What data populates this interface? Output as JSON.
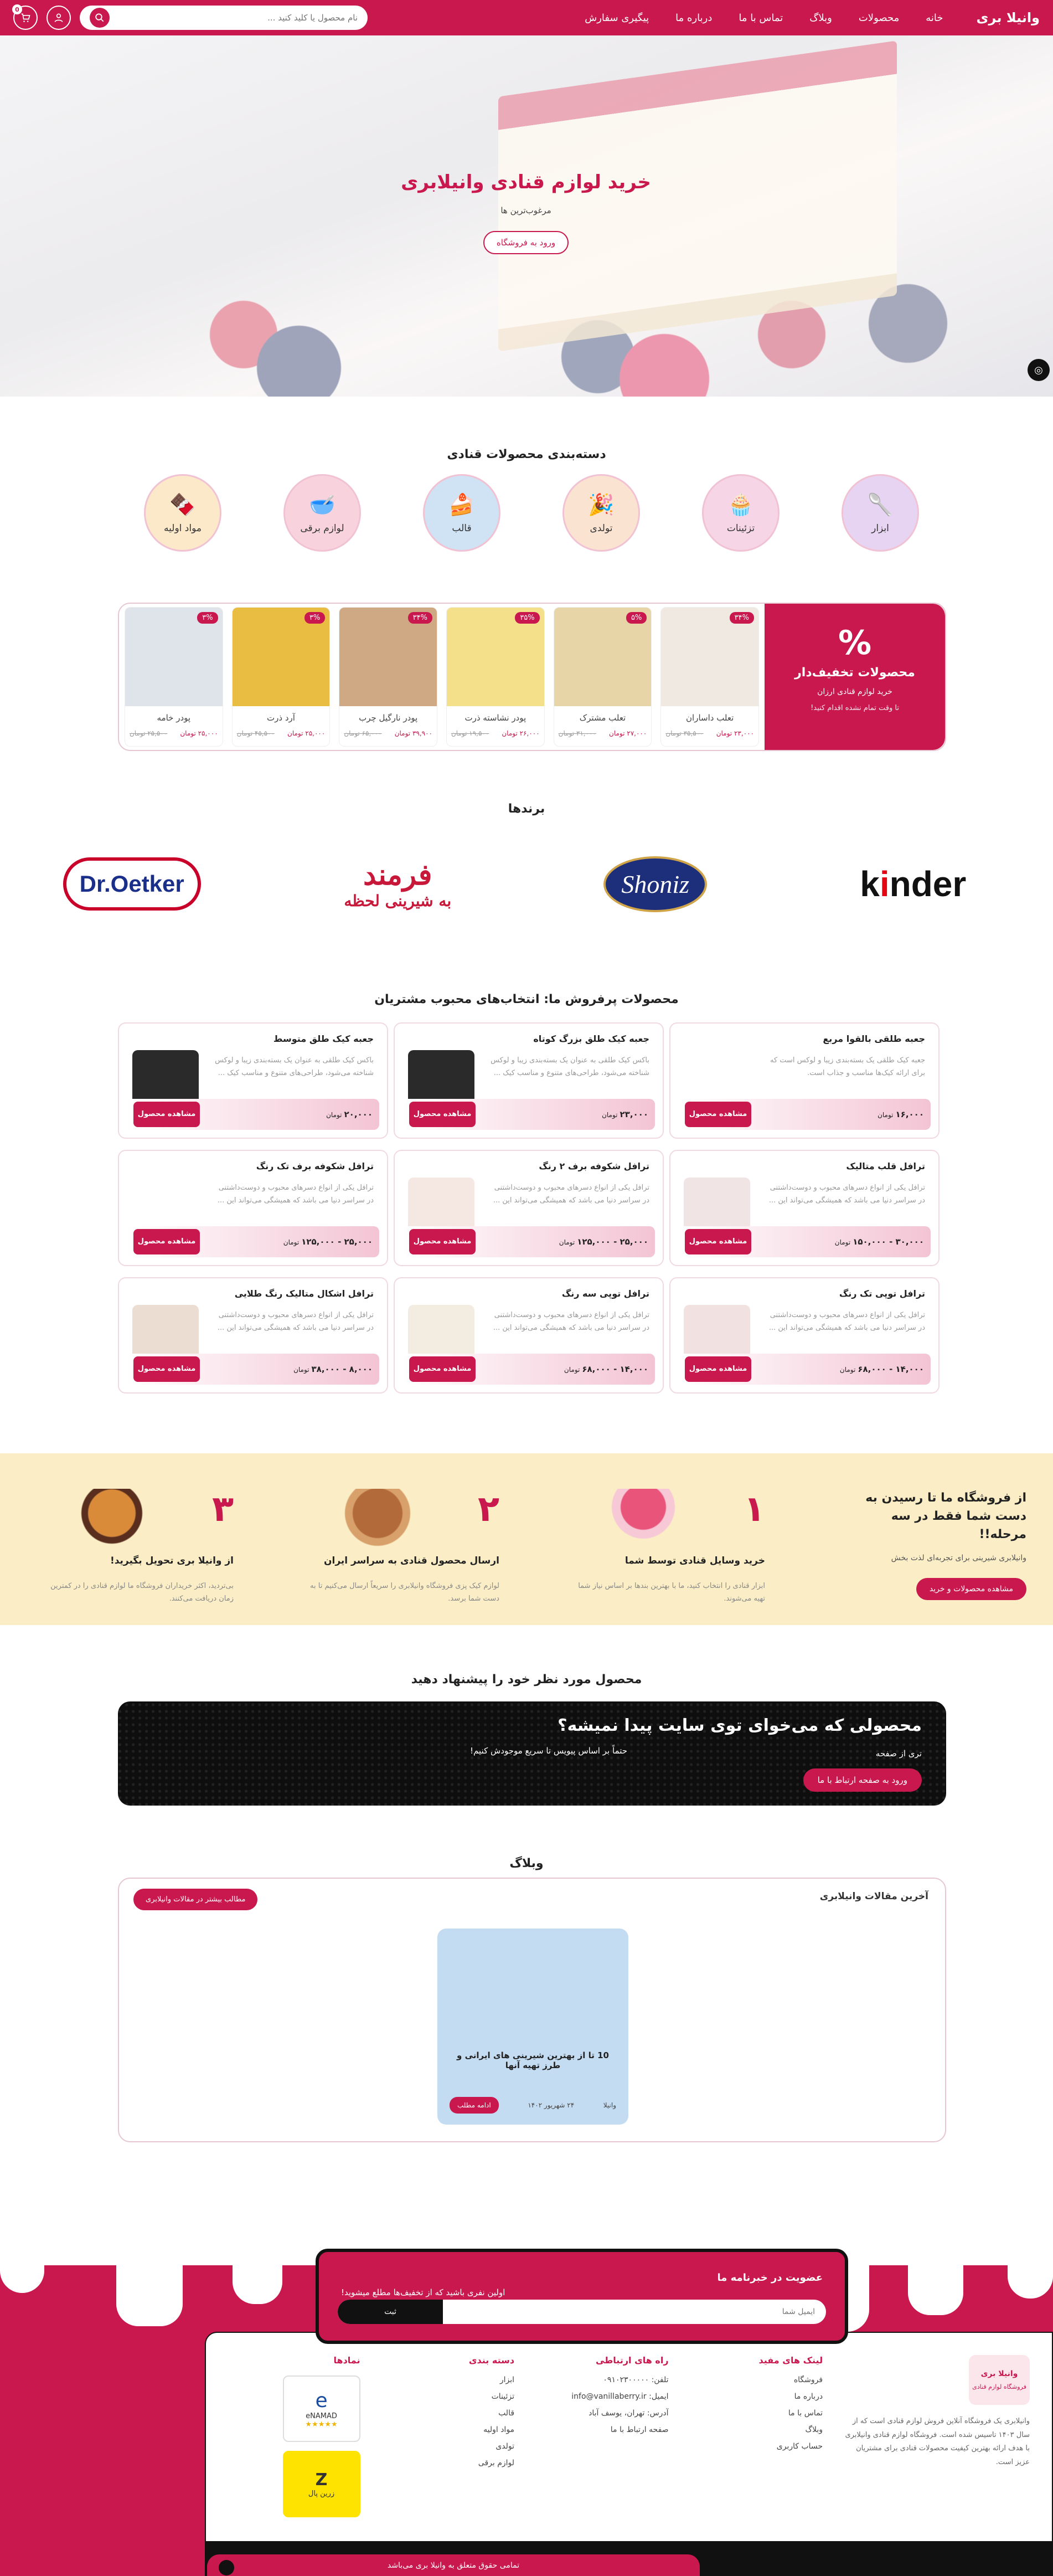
{
  "header": {
    "brand": "وانیلا بری",
    "nav": [
      "خانه",
      "محصولات",
      "وبلاگ",
      "تماس با ما",
      "درباره ما",
      "پیگیری سفارش"
    ],
    "search_placeholder": "نام محصول یا کلید کنید ..."
  },
  "hero": {
    "title": "خرید لوازم قنادی وانیلابری",
    "subtitle": "مرغوب‌ترین ها",
    "button": "ورود به فروشگاه"
  },
  "categories": {
    "title": "دسته‌بندی محصولات قنادی",
    "items": [
      {
        "label": "ابزار",
        "icon": "🥄",
        "bg": "#e7d4f2"
      },
      {
        "label": "تزئینات",
        "icon": "🧁",
        "bg": "#f6d5e6"
      },
      {
        "label": "تولدی",
        "icon": "🎉",
        "bg": "#fbe3d2"
      },
      {
        "label": "قالب",
        "icon": "🍰",
        "bg": "#cfe3f5"
      },
      {
        "label": "لوازم برقی",
        "icon": "🥣",
        "bg": "#f8d3de"
      },
      {
        "label": "مواد اولیه",
        "icon": "🍫",
        "bg": "#fbe9c9"
      }
    ]
  },
  "discount": {
    "pct_icon": "%",
    "title": "محصولات تخفیف‌دار",
    "subtitle": "خرید لوازم قنادی ارزان",
    "note": "تا وقت تمام نشده اقدام کنید!",
    "products": [
      {
        "name": "تعلب داساران",
        "price": "۲۳,۰۰۰ تومان",
        "old": "۳۵,۵۰۰ تومان",
        "badge": "۳۴%",
        "img": "#efe9e1"
      },
      {
        "name": "تعلب مشترک",
        "price": "۲۷,۰۰۰ تومان",
        "old": "۳۱,۰۰۰ تومان",
        "badge": "۵%",
        "img": "#e7d5a7"
      },
      {
        "name": "پودر نشاسته ذرت",
        "price": "۲۶,۰۰۰ تومان",
        "old": "۱۹,۵۰۰ تومان",
        "badge": "۳۵%",
        "img": "#f4e08a"
      },
      {
        "name": "پودر نارگیل چرب",
        "price": "۳۹,۹۰۰ تومان",
        "old": "۶۵,۰۰۰ تومان",
        "badge": "۳۴%",
        "img": "#cfa983"
      },
      {
        "name": "آرد ذرت",
        "price": "۲۵,۰۰۰ تومان",
        "old": "۴۵,۵۰۰ تومان",
        "badge": "۳%",
        "img": "#e9bd42"
      },
      {
        "name": "پودر خامه",
        "price": "۲۵,۰۰۰ تومان",
        "old": "۲۵,۵۰۰ تومان",
        "badge": "۳%",
        "img": "#dfe3ea"
      }
    ]
  },
  "brands": {
    "title": "برندها",
    "items": [
      "kinder",
      "Shoniz",
      "فرمند",
      "Dr.Oetker"
    ]
  },
  "bestsellers": {
    "title": "محصولات پرفروش ما: انتخاب‌های محبوب مشتریان",
    "button": "مشاهده محصول",
    "unit": "تومان",
    "items": [
      {
        "name": "جعبه طلقی بالقوا مربع",
        "desc": "جعبه کیک طلقی یک بسته‌بندی زیبا و لوکس است که برای ارائه کیک‌ها مناسب و جذاب است.",
        "price": "۱۶,۰۰۰",
        "img": ""
      },
      {
        "name": "جعبه کیک طلق بزرگ کوتاه",
        "desc": "باکس کیک طلقی به عنوان یک بسته‌بندی زیبا و لوکس شناخته می‌شود، طراحی‌های متنوع و مناسب کیک ...",
        "price": "۲۳,۰۰۰",
        "img": "#2a2a2a"
      },
      {
        "name": "جعبه کیک طلق متوسط",
        "desc": "باکس کیک طلقی به عنوان یک بسته‌بندی زیبا و لوکس شناخته می‌شود، طراحی‌های متنوع و مناسب کیک ...",
        "price": "۲۰,۰۰۰",
        "img": "#2a2a2a"
      },
      {
        "name": "ترافل قلب متالیک",
        "desc": "ترافل یکی از انواع دسرهای محبوب و دوست‌داشتنی در سراسر دنیا می باشد که همیشگی می‌تواند این ...",
        "price": "۳۰,۰۰۰ - ۱۵۰,۰۰۰",
        "img": "#f1e4e4"
      },
      {
        "name": "ترافل شکوفه برف ۲ رنگ",
        "desc": "ترافل یکی از انواع دسرهای محبوب و دوست‌داشتنی در سراسر دنیا می باشد که همیشگی می‌تواند این ...",
        "price": "۲۵,۰۰۰ - ۱۲۵,۰۰۰",
        "img": "#f5e8e3"
      },
      {
        "name": "ترافل شکوفه برف تک رنگ",
        "desc": "ترافل یکی از انواع دسرهای محبوب و دوست‌داشتنی در سراسر دنیا می باشد که همیشگی می‌تواند این ...",
        "price": "۲۵,۰۰۰ - ۱۲۵,۰۰۰",
        "img": ""
      },
      {
        "name": "ترافل توپی تک رنگ",
        "desc": "ترافل یکی از انواع دسرهای محبوب و دوست‌داشتنی در سراسر دنیا می باشد که همیشگی می‌تواند این ...",
        "price": "۱۴,۰۰۰ - ۶۸,۰۰۰",
        "img": "#f2e1e1"
      },
      {
        "name": "ترافل توپی سه رنگ",
        "desc": "ترافل یکی از انواع دسرهای محبوب و دوست‌داشتنی در سراسر دنیا می باشد که همیشگی می‌تواند این ...",
        "price": "۱۴,۰۰۰ - ۶۸,۰۰۰",
        "img": "#f3ece0"
      },
      {
        "name": "ترافل اشکال متالیک رنگ طلایی",
        "desc": "ترافل یکی از انواع دسرهای محبوب و دوست‌داشتنی در سراسر دنیا می باشد که همیشگی می‌تواند این ...",
        "price": "۸,۰۰۰ - ۳۸,۰۰۰",
        "img": "#ecddd2"
      }
    ]
  },
  "steps": {
    "intro_title": "از فروشگاه ما تا رسیدن به دست شما فقط در سه مرحله!!",
    "intro_sub": "وانیلابری شیرینی برای تجربه‌ای لذت بخش",
    "intro_button": "مشاهده محصولات و خرید",
    "items": [
      {
        "num": "۱",
        "title": "خرید وسایل قنادی توسط شما",
        "desc": "ابزار قنادی را انتخاب کنید، ما با بهترین بندها بر اساس نیاز شما تهیه می‌شوند.",
        "color": "#e9547b"
      },
      {
        "num": "۲",
        "title": "ارسال محصول قنادی به سراسر ایران",
        "desc": "لوازم کیک پزی فروشگاه وانیلابری را سریعاً ارسال می‌کنیم تا به دست شما برسد.",
        "color": "#b36a3b"
      },
      {
        "num": "۳",
        "title": "از وانیلا بری تحویل بگیرید!",
        "desc": "بی‌تردید، اکثر خریداران فروشگاه ما لوازم قنادی را در کمترین زمان دریافت می‌کنند.",
        "color": "#d98b3a"
      }
    ]
  },
  "request": {
    "title": "محصول مورد نظر خود را پیشنهاد دهید",
    "banner_title": "محصولی که می‌خوای توی سایت پیدا نمیشه؟",
    "banner_label": "تری از صفحه",
    "banner_line": "حتماً بر اساس پیویس تا سریع موجودش کنیم!",
    "button": "ورود به صفحه ارتباط با ما"
  },
  "blog": {
    "title": "وبلاگ",
    "header": "آخرین مقالات وانیلابری",
    "more": "مطالب بیشتر در مقالات وانیلابری",
    "post_title": "10 تا از بهترین شیرینی های ایرانی و طرز تهیه آنها",
    "post_date": "۲۴ شهریور ۱۴۰۲",
    "post_author": "وانیلا",
    "post_button": "ادامه مطلب"
  },
  "newsletter": {
    "title": "عضویت در خبرنامه ما",
    "subtitle": "اولین نفری باشید که از تخفیف‌ها مطلع میشوید!",
    "placeholder": "ایمیل شما",
    "button": "ثبت"
  },
  "footer": {
    "about": "وانیلابری یک فروشگاه آنلاین فروش لوازم قنادی است که از سال ۱۴۰۳ تاسیس شده است. فروشگاه لوازم قنادی وانیلابری با هدف ارائه بهترین کیفیت محصولات قنادی برای مشتریان عزیز است.",
    "logo": "وانیلا بری",
    "logo_sub": "فروشگاه لوازم قنادی",
    "cols": [
      {
        "title": "لینک های مفید",
        "items": [
          "فروشگاه",
          "درباره ما",
          "تماس با ما",
          "وبلاگ",
          "حساب کاربری"
        ]
      },
      {
        "title": "راه های ارتباطی",
        "items": [
          "تلفن: ۰۹۱۰۲۳۰۰۰۰۰",
          "ایمیل: info@vanillaberry.ir",
          "آدرس: تهران، یوسف آباد",
          "صفحه ارتباط با ما"
        ]
      },
      {
        "title": "دسته بندی",
        "items": [
          "ابزار",
          "تزئینات",
          "قالب",
          "مواد اولیه",
          "تولدی",
          "لوازم برقی"
        ]
      },
      {
        "title": "نمادها",
        "items": [
          "eNAMAD",
          "زرین پال"
        ]
      }
    ],
    "bottom": "تمامی حقوق متعلق به وانیلا بری می‌باشد"
  },
  "colors": {
    "accent": "#c8184e",
    "steps_bg": "#fbeec6"
  }
}
